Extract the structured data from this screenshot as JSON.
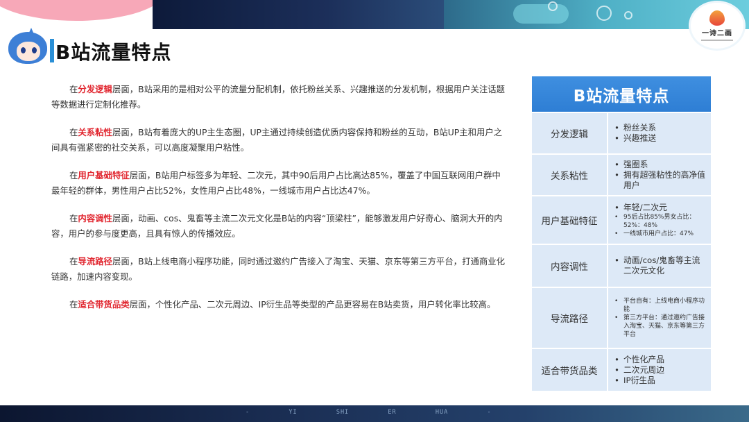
{
  "header": {
    "title": "B站流量特点",
    "logo_text": "一诗二画"
  },
  "paragraphs": [
    {
      "prefix": "在",
      "keyword": "分发逻辑",
      "text": "层面，B站采用的是相对公平的流量分配机制，依托粉丝关系、兴趣推送的分发机制，根据用户关注话题等数据进行定制化推荐。"
    },
    {
      "prefix": "在",
      "keyword": "关系粘性",
      "text": "层面，B站有着庞大的UP主生态圈，UP主通过持续创造优质内容保持和粉丝的互动，B站UP主和用户之间具有强紧密的社交关系，可以高度凝聚用户粘性。"
    },
    {
      "prefix": "在",
      "keyword": "用户基础特征",
      "text": "层面，B站用户标签多为年轻、二次元，其中90后用户占比高达85%，覆盖了中国互联网用户群中最年轻的群体，男性用户占比52%，女性用户占比48%，一线城市用户占比达47%。"
    },
    {
      "prefix": "在",
      "keyword": "内容调性",
      "text": "层面，动画、cos、鬼畜等主流二次元文化是B站的内容“顶梁柱”，能够激发用户好奇心、脑洞大开的内容，用户的参与度更高，且具有惊人的传播效应。"
    },
    {
      "prefix": "在",
      "keyword": "导流路径",
      "text": "层面，B站上线电商小程序功能，同时通过邀约广告接入了淘宝、天猫、京东等第三方平台，打通商业化链路，加速内容变现。"
    },
    {
      "prefix": "在",
      "keyword": "适合带货品类",
      "text": "层面，个性化产品、二次元周边、IP衍生品等类型的产品更容易在B站卖货，用户转化率比较高。"
    }
  ],
  "table": {
    "title": "B站流量特点",
    "rows": [
      {
        "category": "分发逻辑",
        "points": [
          {
            "t": "粉丝关系"
          },
          {
            "t": "兴趣推送"
          }
        ]
      },
      {
        "category": "关系粘性",
        "points": [
          {
            "t": "强圈系"
          },
          {
            "t": "拥有超强粘性的高净值用户"
          }
        ]
      },
      {
        "category": "用户基础特征",
        "points": [
          {
            "t": "年轻/二次元"
          },
          {
            "t": "95后占比85%男女占比：52%：48%",
            "small": true
          },
          {
            "t": "一线城市用户占比：47%",
            "small": true
          }
        ]
      },
      {
        "category": "内容调性",
        "points": [
          {
            "t": "动画/cos/鬼畜等主流二次元文化"
          }
        ]
      },
      {
        "category": "导流路径",
        "points": [
          {
            "t": "平台自有：上线电商小程序功能",
            "small": true
          },
          {
            "t": "第三方平台：通过邀约广告接入淘宝、天猫、京东等第三方平台",
            "small": true
          }
        ]
      },
      {
        "category": "适合带货品类",
        "points": [
          {
            "t": "个性化产品"
          },
          {
            "t": "二次元周边"
          },
          {
            "t": "IP衍生品"
          }
        ]
      }
    ]
  },
  "footer": {
    "text": "-  YI  SHI  ER  HUA  -"
  }
}
